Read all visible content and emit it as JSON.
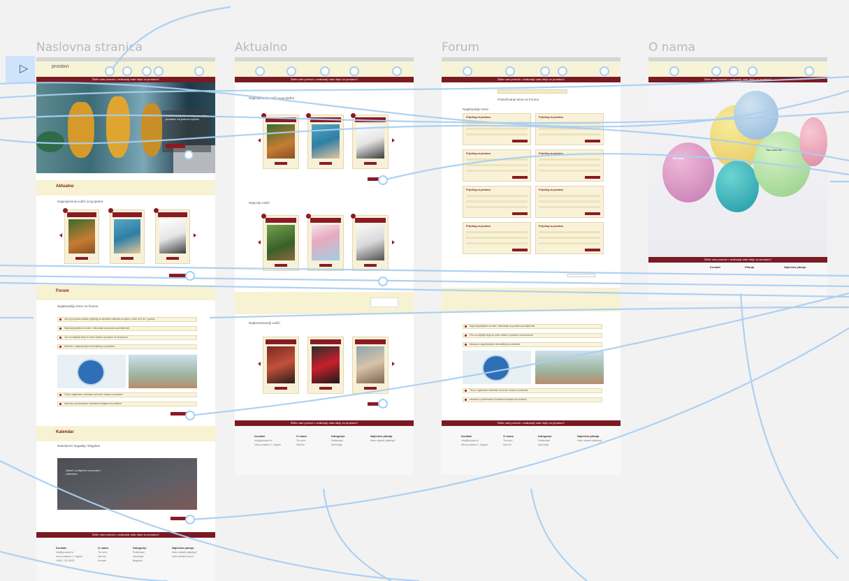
{
  "frames": {
    "home": {
      "title": "Naslovna stranica",
      "logo": "proslavi",
      "banner": "Želite vam pomoći u realizaciji vaše ideje za proslavu?",
      "hero_text": "Kreativni prijedlozi i ideje za vašu proslavu na jednom mjestu",
      "aktualno_title": "Aktualno",
      "aktualno_sub": "Najposjećeniji vodiči ovog tjedna",
      "forum_title": "Forum",
      "forum_sub": "Najaktualnije teme na forumu",
      "forum_rows": [
        "Ovo je još jedan odličan prijedlog za tematski rođendan za djecu u dobi od 5 do 7 godina",
        "Najnoviji prijedlozi za torte i dekoracije za proslavu punoljetnosti",
        "Ovo su najbolje ideje za vrtne zabave i proslave na otvorenom",
        "Iskustva s organizacijom iznenađenja za partnera"
      ],
      "forum_rows_2": [
        "Tko je organizirao rođendan na brodu i kakva su iskustva",
        "Iskustva s pozivnicama i kreativnim idejama za proslave"
      ],
      "kalendar_title": "Kalendar",
      "kalendar_sub": "Nadolazeći događaji i blagdani",
      "kalendar_text": "Datumi i podsjetnici za proslave i rođendane",
      "footer_banner": "Želite vam pomoći u realizaciji vaše ideje za proslavu?",
      "footer_cols": [
        {
          "head": "Kontakt",
          "items": [
            "info@proslavi.hr",
            "Ulica proslava 1, Zagreb",
            "+385 1 234 5678"
          ]
        },
        {
          "head": "O nama",
          "items": [
            "Tko smo",
            "Naš tim",
            "Kontakt"
          ]
        },
        {
          "head": "Kategorije",
          "items": [
            "Rođendani",
            "Vjenčanja",
            "Blagdani"
          ]
        },
        {
          "head": "Najčešća pitanja",
          "items": [
            "Kako objaviti prijedlog?",
            "Kako koristiti forum?"
          ]
        }
      ]
    },
    "aktualno": {
      "title": "Aktualno",
      "banner": "Želite vam pomoći u realizaciji vaše ideje za proslavu?",
      "section1": "Najposjećeniji vodiči ovog tjedna",
      "section2": "Najnoviji vodiči",
      "section3": "Najkomentiraniji vodiči"
    },
    "forum": {
      "title": "Forum",
      "banner": "Želite vam pomoći u realizaciji vaše ideje za proslavu?",
      "header": "Pretraživanje teme na forumu",
      "list_head": "Najaktualnije teme",
      "box_title": "Prijedlog za proslavu",
      "box_text": "Moj prijedlog za temu: \"Rođendan\" s idejom za dekoracije i hranu",
      "rows": [
        "Najnoviji prijedlozi za torte i dekoracije za proslavu punoljetnosti",
        "Ovo su najbolje ideje za vrtne zabave i proslave na otvorenom",
        "Iskustva s organizacijom iznenađenja za partnera",
        "Tko je organizirao rođendan na brodu i kakva su iskustva",
        "Iskustva s pozivnicama i kreativnim idejama za proslave"
      ]
    },
    "onama": {
      "title": "O nama",
      "banner": "Želite vam pomoći u realizaciji vaše ideje za proslavu?",
      "balloon_left": "Tko smo",
      "balloon_right": "Tko smo mi?",
      "table_head": [
        "Kontakt",
        "Pitanja",
        "Najčešća pitanja"
      ]
    }
  },
  "colors": {
    "canvas": "#f2f2f2",
    "brand": "#7a1a23",
    "cream": "#f7f2d2",
    "connector": "#a9cff2"
  },
  "icons": [
    "play-icon",
    "social-icon"
  ]
}
